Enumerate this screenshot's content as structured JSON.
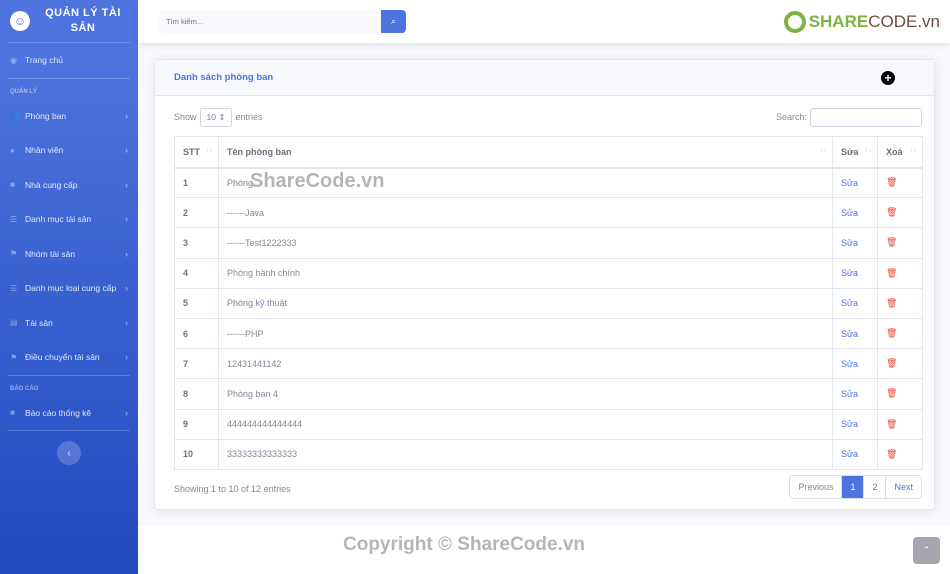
{
  "sidebar": {
    "brand": "QUẢN LÝ TÀI SẢN",
    "home": "Trang chủ",
    "section_manage": "QUẢN LÝ",
    "items": [
      {
        "label": "Phòng ban",
        "icon": "users-icon"
      },
      {
        "label": "Nhân viên",
        "icon": "user-icon"
      },
      {
        "label": "Nhà cung cấp",
        "icon": "building-icon"
      },
      {
        "label": "Danh mục tài sản",
        "icon": "list-icon"
      },
      {
        "label": "Nhóm tài sản",
        "icon": "flag-icon"
      },
      {
        "label": "Danh mục loại cung cấp",
        "icon": "list-icon"
      },
      {
        "label": "Tài sản",
        "icon": "file-icon"
      },
      {
        "label": "Điều chuyển tài sản",
        "icon": "flag-icon"
      }
    ],
    "section_report": "BÁO CÁO",
    "report": "Báo cáo thống kê"
  },
  "topbar": {
    "search_placeholder": "Tìm kiếm...",
    "logo_text_a": "SHARE",
    "logo_text_b": "CODE.vn"
  },
  "card": {
    "title": "Danh sách phòng ban",
    "show": "Show",
    "entries_value": "10",
    "entries": "entries",
    "search_label": "Search:",
    "columns": [
      "STT",
      "Tên phòng ban",
      "Sửa",
      "Xoá"
    ],
    "rows": [
      [
        "1",
        "Phòng"
      ],
      [
        "2",
        "------Java"
      ],
      [
        "3",
        "------Test1222333"
      ],
      [
        "4",
        "Phòng hành chính"
      ],
      [
        "5",
        "Phòng kỹ thuật"
      ],
      [
        "6",
        "------PHP"
      ],
      [
        "7",
        "12431441142"
      ],
      [
        "8",
        "Phòng ban 4"
      ],
      [
        "9",
        "444444444444444"
      ],
      [
        "10",
        "33333333333333"
      ]
    ],
    "edit_label": "Sửa",
    "info": "Showing 1 to 10 of 12 entries",
    "pager": [
      "Previous",
      "1",
      "2",
      "Next"
    ]
  },
  "watermark": {
    "center": "ShareCode.vn",
    "footer": "Copyright © ShareCode.vn"
  }
}
